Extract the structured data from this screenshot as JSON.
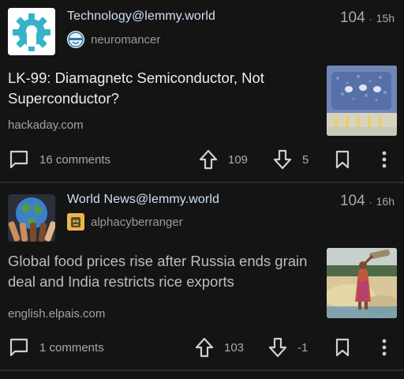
{
  "posts": [
    {
      "community": "Technology@lemmy.world",
      "user": "neuromancer",
      "score": "104",
      "separator": "·",
      "age": "15h",
      "title": "LK-99: Diamagnetc Semiconductor, Not Superconductor?",
      "domain": "hackaday.com",
      "comments": "16 comments",
      "upvotes": "109",
      "downvotes": "5",
      "community_icon": "gear-lemmy-icon",
      "accent": "#3bb6c9"
    },
    {
      "community": "World News@lemmy.world",
      "user": "alphacyberranger",
      "score": "104",
      "separator": "·",
      "age": "16h",
      "title": "Global food prices rise after Russia ends grain deal and India restricts rice exports",
      "domain": "english.elpais.com",
      "comments": "1 comments",
      "upvotes": "103",
      "downvotes": "-1",
      "community_icon": "globe-hands-icon"
    }
  ],
  "colors": {
    "background": "#141414",
    "divider": "#2c2c2c",
    "community_text": "#cfe0f3",
    "muted_text": "#a9a9a9"
  },
  "icons": [
    "comment-icon",
    "upvote-icon",
    "downvote-icon",
    "bookmark-icon",
    "more-vert-icon"
  ]
}
